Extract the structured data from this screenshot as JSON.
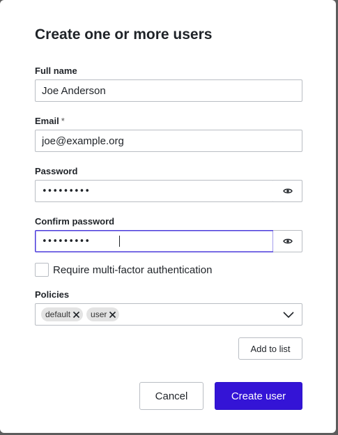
{
  "dialog": {
    "title": "Create one or more users"
  },
  "form": {
    "full_name": {
      "label": "Full name",
      "value": "Joe Anderson"
    },
    "email": {
      "label": "Email",
      "required_marker": "*",
      "value": "joe@example.org"
    },
    "password": {
      "label": "Password",
      "value": "•••••••••"
    },
    "confirm_password": {
      "label": "Confirm password",
      "value": "•••••••••",
      "focused": true
    },
    "mfa": {
      "label": "Require multi-factor authentication",
      "checked": false
    },
    "policies": {
      "label": "Policies",
      "chips": [
        {
          "label": "default"
        },
        {
          "label": "user"
        }
      ]
    }
  },
  "buttons": {
    "add_to_list": "Add to list",
    "cancel": "Cancel",
    "create_user": "Create user"
  },
  "icons": {
    "show_password": "eye-icon",
    "remove_chip": "close-icon",
    "dropdown": "chevron-down-icon"
  },
  "colors": {
    "primary": "#3414d6",
    "focus_border": "#4a3adb",
    "chip_bg": "#e3e3e3"
  }
}
